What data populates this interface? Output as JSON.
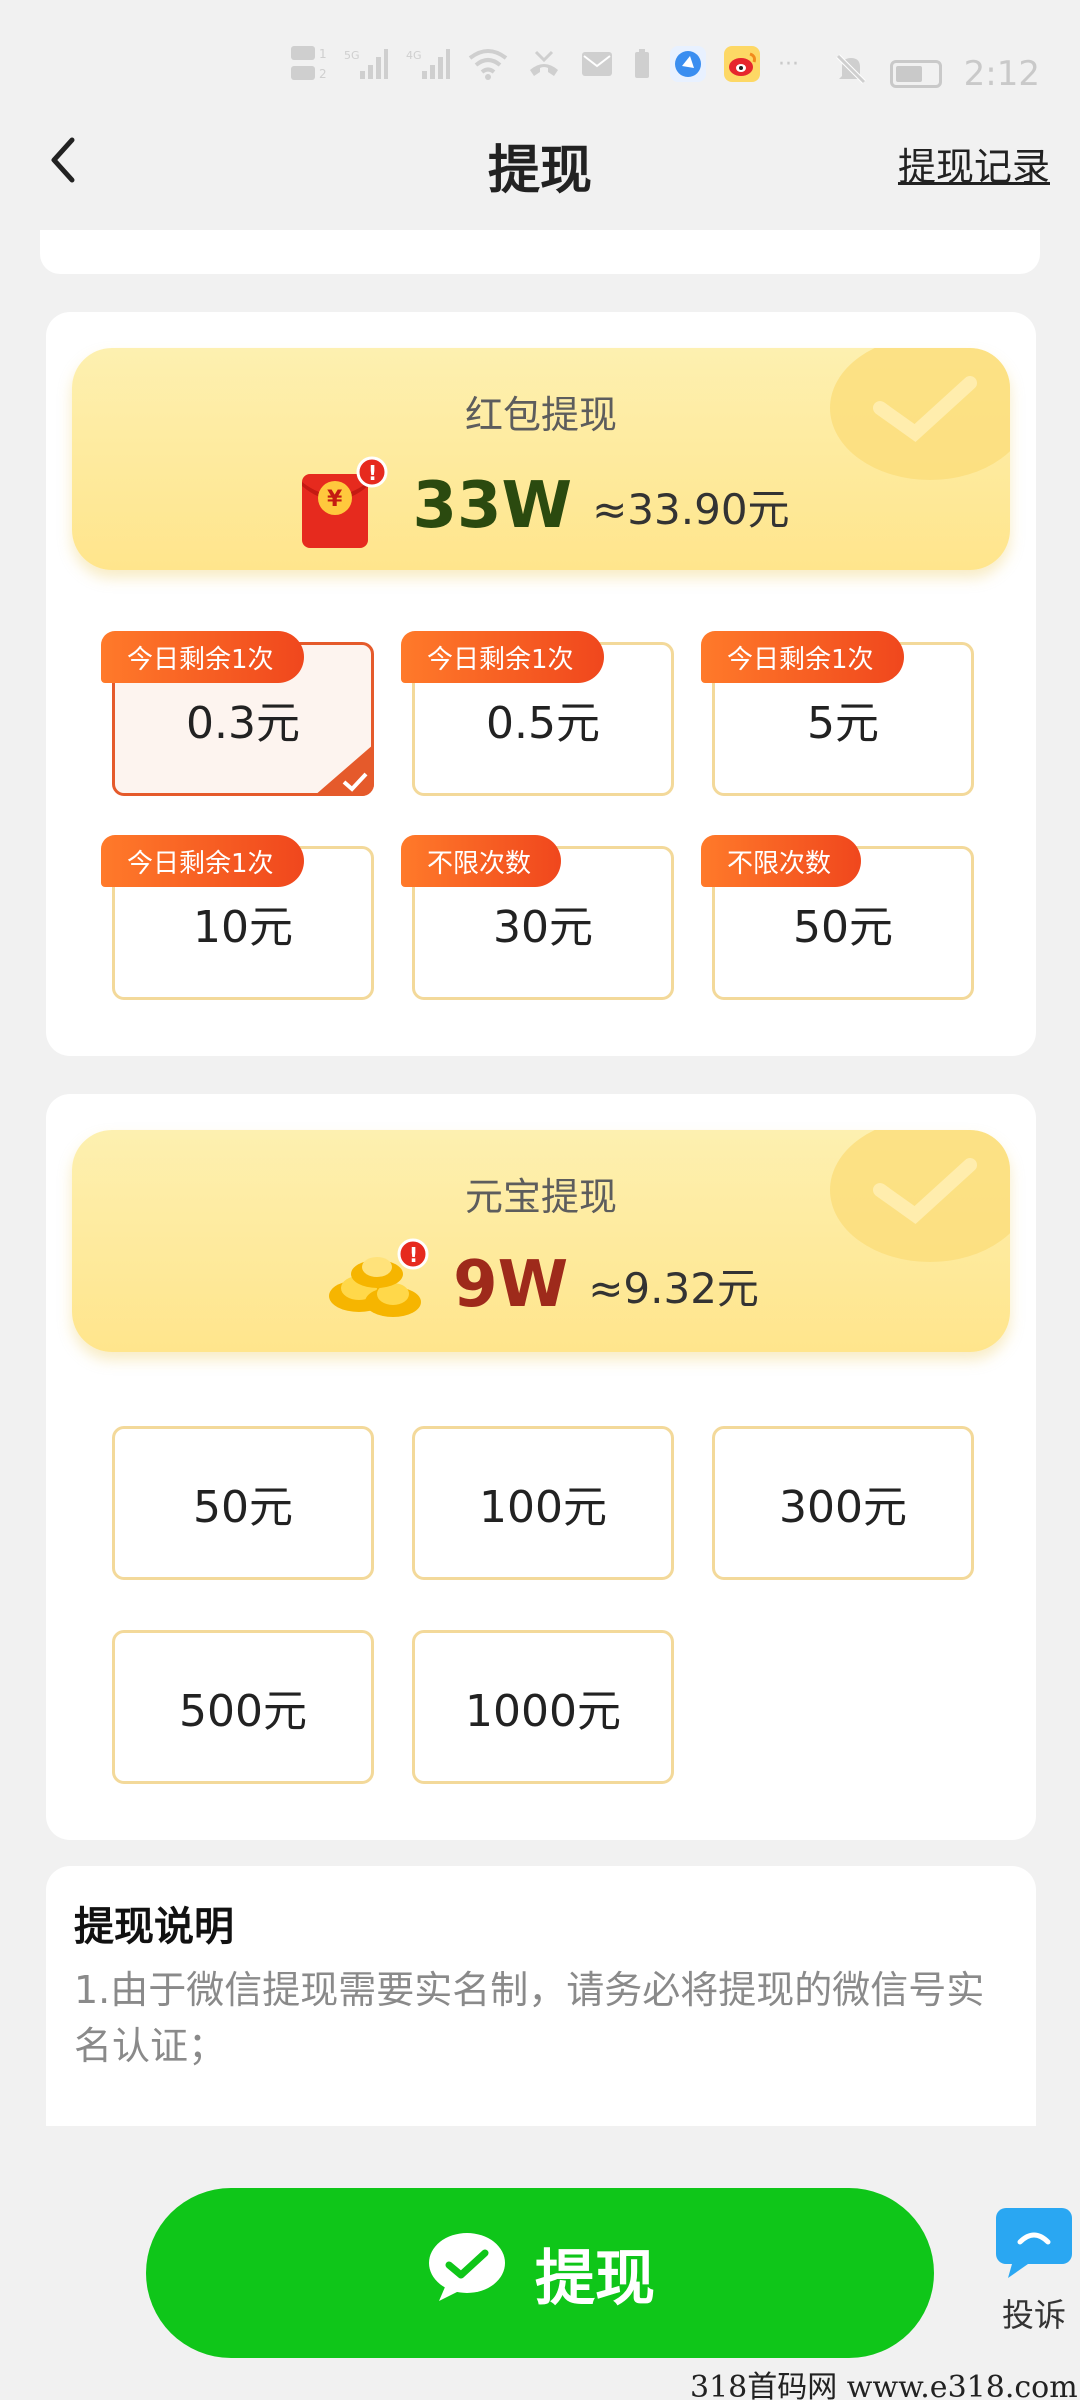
{
  "status_bar": {
    "time": "2:12",
    "left_icons": [
      "hd-icon",
      "5g-signal-icon",
      "4g-signal-icon",
      "wifi-icon",
      "missed-call-icon",
      "message-icon",
      "battery-saver-icon",
      "app-icon",
      "weibo-icon",
      "more-dots-icon"
    ],
    "dots": "···"
  },
  "header": {
    "title": "提现",
    "record_link": "提现记录"
  },
  "red_packet": {
    "label": "红包提现",
    "amount": "33W",
    "approx": "≈33.90元",
    "options": [
      {
        "tag": "今日剩余1次",
        "value": "0.3元",
        "selected": true
      },
      {
        "tag": "今日剩余1次",
        "value": "0.5元",
        "selected": false
      },
      {
        "tag": "今日剩余1次",
        "value": "5元",
        "selected": false
      },
      {
        "tag": "今日剩余1次",
        "value": "10元",
        "selected": false
      },
      {
        "tag": "不限次数",
        "value": "30元",
        "selected": false
      },
      {
        "tag": "不限次数",
        "value": "50元",
        "selected": false
      }
    ]
  },
  "ingot": {
    "label": "元宝提现",
    "amount": "9W",
    "approx": "≈9.32元",
    "options": [
      {
        "value": "50元"
      },
      {
        "value": "100元"
      },
      {
        "value": "300元"
      },
      {
        "value": "500元"
      },
      {
        "value": "1000元"
      }
    ]
  },
  "notice": {
    "title": "提现说明",
    "text": "1.由于微信提现需要实名制，请务必将提现的微信号实名认证；"
  },
  "cta": {
    "label": "提现"
  },
  "complain": {
    "label": "投诉"
  },
  "watermark": "318首码网  www.e318.com",
  "colors": {
    "primary_green": "#0fc619",
    "tag_orange": "#f0471d",
    "border_gold": "#f3d99a",
    "banner_yellow": "#ffe58c"
  }
}
